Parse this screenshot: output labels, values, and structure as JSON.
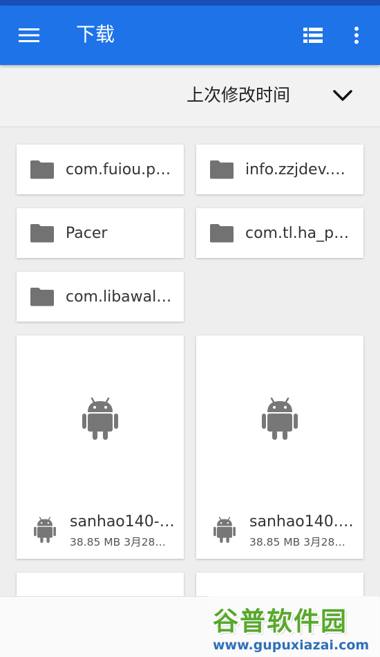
{
  "app_bar": {
    "title": "下载",
    "menu_icon": "hamburger-menu-icon",
    "view_icon": "list-view-icon",
    "more_icon": "more-vert-icon",
    "background_color": "#1e73e8"
  },
  "sort_bar": {
    "label": "上次修改时间",
    "chevron_icon": "chevron-down-icon"
  },
  "folders": [
    {
      "name": "com.fuiou.p…",
      "icon": "folder-icon"
    },
    {
      "name": "info.zzjdev.…",
      "icon": "folder-icon"
    },
    {
      "name": "Pacer",
      "icon": "folder-icon"
    },
    {
      "name": "com.tl.ha_p…",
      "icon": "folder-icon"
    },
    {
      "name": "com.libawal…",
      "icon": "folder-icon"
    }
  ],
  "files": [
    {
      "name": "sanhao140-…",
      "size": "38.85 MB",
      "date": "3月28…",
      "meta": "38.85 MB 3月28…",
      "icon": "android-icon"
    },
    {
      "name": "sanhao140.…",
      "size": "38.85 MB",
      "date": "3月28…",
      "meta": "38.85 MB 3月28…",
      "icon": "android-icon"
    }
  ],
  "watermark": {
    "logo": "谷普软件园",
    "url": "www.gupuxiazai.com"
  }
}
